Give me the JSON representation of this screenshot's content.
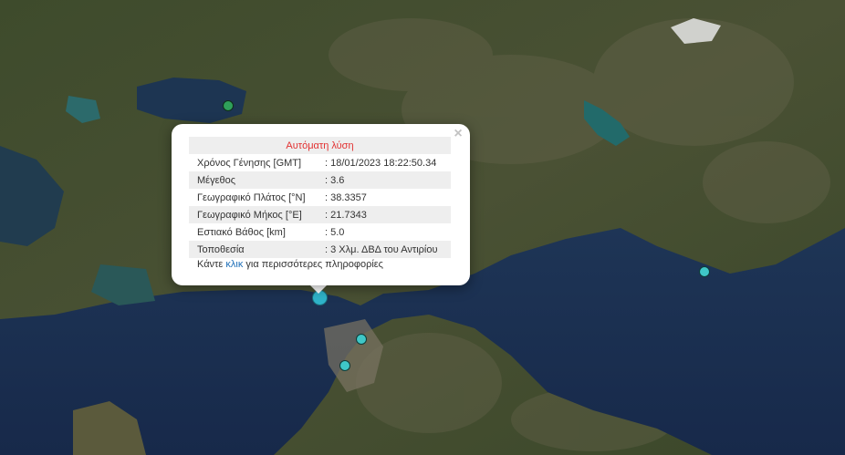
{
  "popup": {
    "title": "Αυτόματη λύση",
    "rows": [
      {
        "label": "Χρόνος Γένησης [GMT]",
        "value": ": 18/01/2023 18:22:50.34"
      },
      {
        "label": "Μέγεθος",
        "value": ": 3.6"
      },
      {
        "label": "Γεωγραφικό Πλάτος [°N]",
        "value": ": 38.3357"
      },
      {
        "label": "Γεωγραφικό Μήκος [°E]",
        "value": ": 21.7343"
      },
      {
        "label": "Εστιακό Βάθος [km]",
        "value": ": 5.0"
      },
      {
        "label": "Τοποθεσία",
        "value": ": 3 Χλμ. ΔΒΔ του Αντιρίου"
      }
    ],
    "footer_prefix": "Κάντε ",
    "footer_link": "κλικ",
    "footer_suffix": " για περισσότερες πληροφορίες",
    "close_symbol": "×"
  },
  "colors": {
    "sea": "#1b3150",
    "land": "#3b4a2b",
    "marker_cyan": "#3fc7c7",
    "marker_green": "#2fa05a",
    "popup_title": "#e23131",
    "link": "#1f6fb8"
  }
}
